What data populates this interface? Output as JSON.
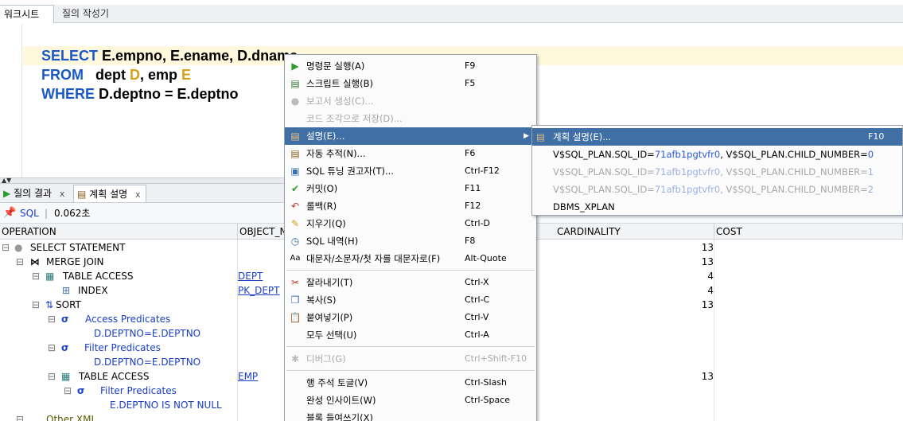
{
  "tabs": [
    {
      "label": "워크시트"
    },
    {
      "label": "질의 작성기"
    }
  ],
  "editor": {
    "lines": [
      {
        "kw": "SELECT",
        "rest": " E.empno, E.ename, D.dname"
      },
      {
        "kw": "FROM",
        "rest_a": "   dept ",
        "alias1": "D",
        "rest_b": ", emp ",
        "alias2": "E"
      },
      {
        "kw": "WHERE",
        "rest": " D.deptno = E.deptno"
      }
    ]
  },
  "bottom_tabs": [
    {
      "label": "질의 결과",
      "close": "x"
    },
    {
      "label": "계획 설명",
      "close": "x"
    }
  ],
  "toolbar": {
    "sql_label": "SQL",
    "separator": "|",
    "time": "0.062초"
  },
  "grid": {
    "headers": [
      "OPERATION",
      "OBJECT_N",
      "CARDINALITY",
      "COST"
    ],
    "rows": [
      {
        "op": "SELECT STATEMENT",
        "obj": "",
        "card": "13"
      },
      {
        "op": "MERGE JOIN",
        "obj": "",
        "card": "13"
      },
      {
        "op": "TABLE ACCESS",
        "obj": "DEPT",
        "card": "4"
      },
      {
        "op": "INDEX",
        "obj": "PK_DEPT",
        "card": "4"
      },
      {
        "op": "SORT",
        "obj": "",
        "card": "13"
      },
      {
        "op": "Access Predicates",
        "obj": "",
        "card": ""
      },
      {
        "op": "D.DEPTNO=E.DEPTNO",
        "obj": "",
        "card": ""
      },
      {
        "op": "Filter Predicates",
        "obj": "",
        "card": ""
      },
      {
        "op": "D.DEPTNO=E.DEPTNO",
        "obj": "",
        "card": ""
      },
      {
        "op": "TABLE ACCESS",
        "obj": "EMP",
        "card": "13"
      },
      {
        "op": "Filter Predicates",
        "obj": "",
        "card": ""
      },
      {
        "op": "E.DEPTNO IS NOT NULL",
        "obj": "",
        "card": ""
      },
      {
        "op": "Other XML",
        "obj": "",
        "card": ""
      }
    ]
  },
  "menu": {
    "items": [
      {
        "label": "명령문 실행(A)",
        "shortcut": "F9",
        "icon": "play-icon",
        "disabled": false
      },
      {
        "label": "스크립트 실행(B)",
        "shortcut": "F5",
        "icon": "script-icon",
        "disabled": false
      },
      {
        "label": "보고서 생성(C)...",
        "shortcut": "",
        "icon": "report-icon",
        "disabled": true
      },
      {
        "label": "코드 조각으로 저장(D)...",
        "shortcut": "",
        "icon": "snippet-icon",
        "disabled": true
      },
      {
        "label": "설명(E)...",
        "shortcut": "",
        "icon": "explain-icon",
        "disabled": false
      },
      {
        "label": "자동 추적(N)...",
        "shortcut": "F6",
        "icon": "autotrace-icon",
        "disabled": false
      },
      {
        "label": "SQL 튜닝 권고자(T)...",
        "shortcut": "Ctrl-F12",
        "icon": "tuning-icon",
        "disabled": false
      },
      {
        "label": "커밋(O)",
        "shortcut": "F11",
        "icon": "commit-icon",
        "disabled": false
      },
      {
        "label": "롤백(R)",
        "shortcut": "F12",
        "icon": "rollback-icon",
        "disabled": false
      },
      {
        "label": "지우기(Q)",
        "shortcut": "Ctrl-D",
        "icon": "eraser-icon",
        "disabled": false
      },
      {
        "label": "SQL 내역(H)",
        "shortcut": "F8",
        "icon": "history-icon",
        "disabled": false
      },
      {
        "label": "대문자/소문자/첫 자를 대문자로(F)",
        "shortcut": "Alt-Quote",
        "icon": "case-icon",
        "disabled": false
      },
      {
        "label": "잘라내기(T)",
        "shortcut": "Ctrl-X",
        "icon": "cut-icon",
        "disabled": false
      },
      {
        "label": "복사(S)",
        "shortcut": "Ctrl-C",
        "icon": "copy-icon",
        "disabled": false
      },
      {
        "label": "붙여넣기(P)",
        "shortcut": "Ctrl-V",
        "icon": "paste-icon",
        "disabled": false
      },
      {
        "label": "모두 선택(U)",
        "shortcut": "Ctrl-A",
        "icon": "",
        "disabled": false
      },
      {
        "label": "디버그(G)",
        "shortcut": "Ctrl+Shift-F10",
        "icon": "bug-icon",
        "disabled": true
      },
      {
        "label": "행 주석 토글(V)",
        "shortcut": "Ctrl-Slash",
        "icon": "",
        "disabled": false
      },
      {
        "label": "완성 인사이트(W)",
        "shortcut": "Ctrl-Space",
        "icon": "",
        "disabled": false
      },
      {
        "label": "블록 들여쓰기(X)",
        "shortcut": "",
        "icon": "",
        "disabled": false
      }
    ],
    "submenu_arrow": "▶"
  },
  "submenu": {
    "items": [
      {
        "label": "계획 설명(E)...",
        "shortcut": "F10"
      },
      {
        "prefix": "V$SQL_PLAN.SQL_ID=",
        "sqlid": "71afb1pgtvfr0",
        "mid": ", V$SQL_PLAN.CHILD_NUMBER=",
        "child": "0"
      },
      {
        "prefix": "V$SQL_PLAN.SQL_ID=",
        "sqlid": "71afb1pgtvfr0",
        "mid": ", V$SQL_PLAN.CHILD_NUMBER=",
        "child": "1"
      },
      {
        "prefix": "V$SQL_PLAN.SQL_ID=",
        "sqlid": "71afb1pgtvfr0",
        "mid": ", V$SQL_PLAN.CHILD_NUMBER=",
        "child": "2"
      },
      {
        "label": "DBMS_XPLAN"
      }
    ]
  },
  "colors": {
    "accent": "#3f6fa5",
    "keyword": "#1a57c9",
    "alias": "#d4a017",
    "link": "#1a3ec9"
  }
}
